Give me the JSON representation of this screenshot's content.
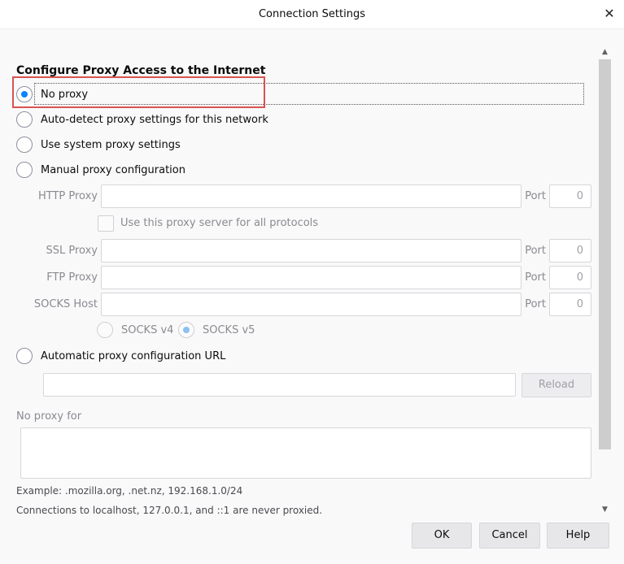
{
  "dialog": {
    "title": "Connection Settings",
    "close_glyph": "✕"
  },
  "section": {
    "title": "Configure Proxy Access to the Internet"
  },
  "options": {
    "no_proxy": "No proxy",
    "auto_detect": "Auto-detect proxy settings for this network",
    "system": "Use system proxy settings",
    "manual": "Manual proxy configuration",
    "auto_url": "Automatic proxy configuration URL",
    "selected": "no_proxy"
  },
  "manual": {
    "http_label": "HTTP Proxy",
    "http_value": "",
    "http_port": "0",
    "port_label": "Port",
    "use_all_label": "Use this proxy server for all protocols",
    "ssl_label": "SSL Proxy",
    "ssl_value": "",
    "ssl_port": "0",
    "ftp_label": "FTP Proxy",
    "ftp_value": "",
    "ftp_port": "0",
    "socks_label": "SOCKS Host",
    "socks_value": "",
    "socks_port": "0",
    "socks_v4": "SOCKS v4",
    "socks_v5": "SOCKS v5"
  },
  "auto_url": {
    "value": "",
    "reload_label": "Reload"
  },
  "no_proxy_for": {
    "label": "No proxy for",
    "value": "",
    "example": "Example: .mozilla.org, .net.nz, 192.168.1.0/24",
    "note": "Connections to localhost, 127.0.0.1, and ::1 are never proxied."
  },
  "buttons": {
    "ok": "OK",
    "cancel": "Cancel",
    "help": "Help"
  },
  "scrollbar": {
    "up_glyph": "▲",
    "down_glyph": "▼"
  },
  "colors": {
    "accent": "#0a84ff",
    "highlight": "#d9534f"
  }
}
